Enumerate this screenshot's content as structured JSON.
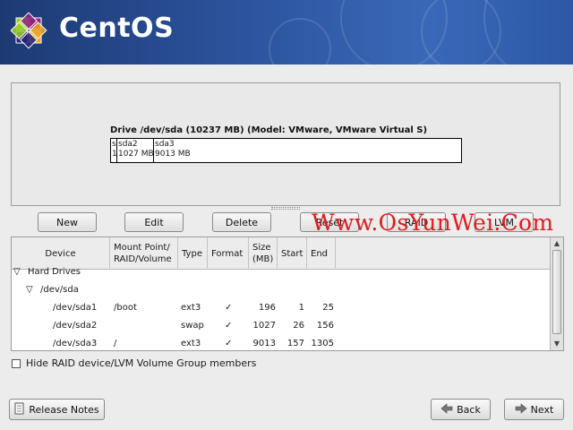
{
  "header": {
    "logo_text": "CentOS"
  },
  "drive": {
    "title": "Drive /dev/sda (10237 MB) (Model: VMware, VMware Virtual S)",
    "segments": [
      {
        "name": "s",
        "size": "1"
      },
      {
        "name": "sda2",
        "size": "1027 MB"
      },
      {
        "name": "sda3",
        "size": "9013 MB"
      }
    ]
  },
  "toolbar": {
    "new": "New",
    "edit": "Edit",
    "delete": "Delete",
    "reset": "Reset",
    "raid": "RAID",
    "lvm": "LVM"
  },
  "watermark": "Www.OsYunWei.Com",
  "table": {
    "columns": [
      "Device",
      "Mount Point/\nRAID/Volume",
      "Type",
      "Format",
      "Size\n(MB)",
      "Start",
      "End"
    ],
    "group": "Hard Drives",
    "drive": "/dev/sda",
    "rows": [
      {
        "device": "/dev/sda1",
        "mount": "/boot",
        "type": "ext3",
        "format": "✓",
        "size": "196",
        "start": "1",
        "end": "25"
      },
      {
        "device": "/dev/sda2",
        "mount": "",
        "type": "swap",
        "format": "✓",
        "size": "1027",
        "start": "26",
        "end": "156"
      },
      {
        "device": "/dev/sda3",
        "mount": "/",
        "type": "ext3",
        "format": "✓",
        "size": "9013",
        "start": "157",
        "end": "1305"
      }
    ]
  },
  "hide_members": {
    "label": "Hide RAID device/LVM Volume Group members",
    "checked": false
  },
  "footer": {
    "release_notes": "Release Notes",
    "back": "Back",
    "next": "Next"
  },
  "colors": {
    "banner": "#2d55a0",
    "watermark": "#e01b1b"
  },
  "icons": {
    "release": "document-icon",
    "back": "arrow-left-icon",
    "next": "arrow-right-icon"
  }
}
